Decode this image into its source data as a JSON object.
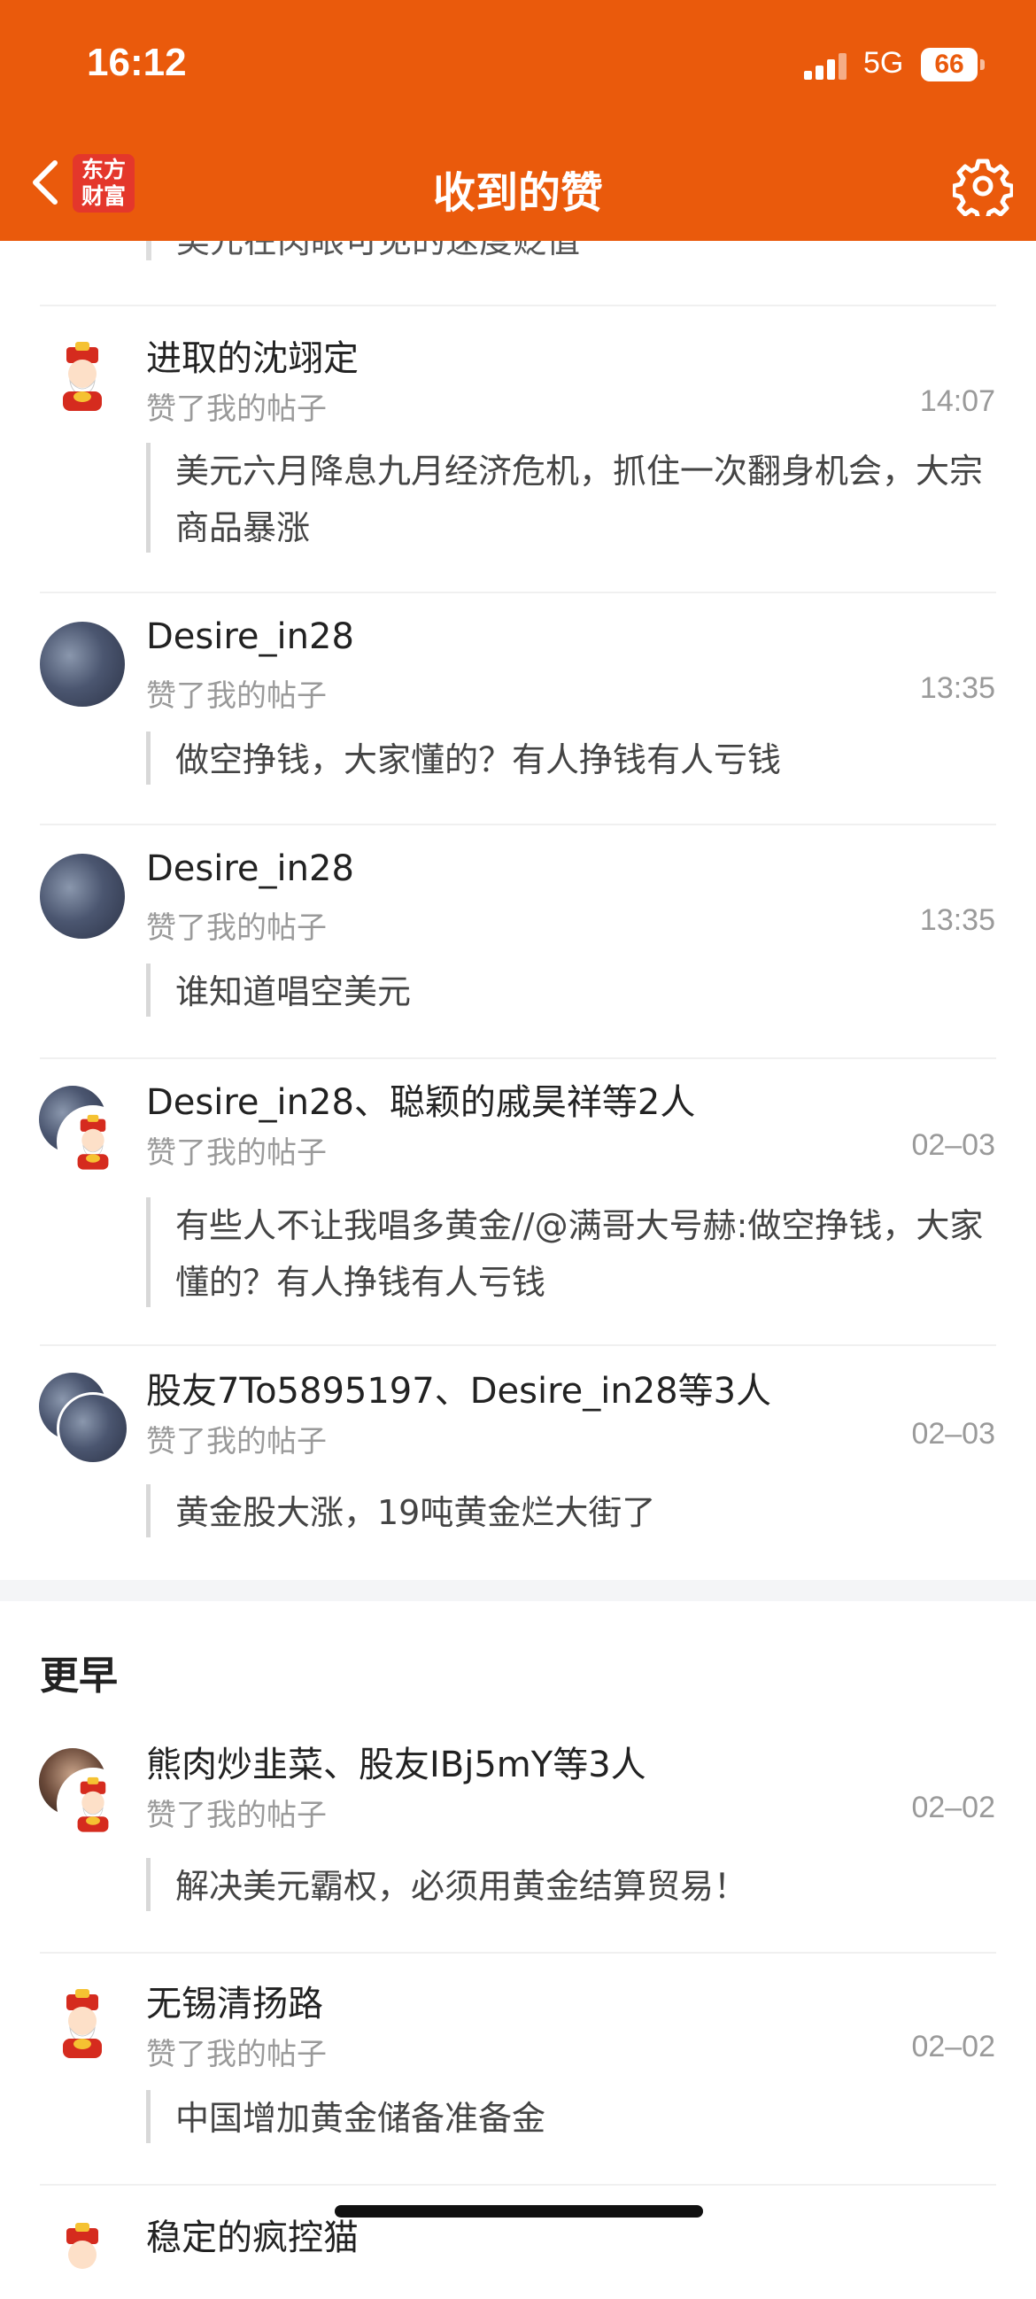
{
  "status_bar": {
    "time": "16:12",
    "network": "5G",
    "battery": "66"
  },
  "header": {
    "logo": "东方财富",
    "logo_line1": "东方",
    "logo_line2": "财富",
    "title": "收到的赞"
  },
  "truncated_top": "美元在肉眼可见的速度贬值",
  "items": [
    {
      "name": "进取的沈翊定",
      "action": "赞了我的帖子",
      "time": "14:07",
      "quote": "美元六月降息九月经济危机，抓住一次翻身机会，大宗商品暴涨"
    },
    {
      "name": "Desire_in28",
      "action": "赞了我的帖子",
      "time": "13:35",
      "quote": "做空挣钱，大家懂的？有人挣钱有人亏钱"
    },
    {
      "name": "Desire_in28",
      "action": "赞了我的帖子",
      "time": "13:35",
      "quote": "谁知道唱空美元"
    },
    {
      "name": "Desire_in28、聪颖的戚昊祥等2人",
      "action": "赞了我的帖子",
      "time": "02–03",
      "quote": "有些人不让我唱多黄金//@满哥大号赫:做空挣钱，大家懂的？有人挣钱有人亏钱"
    },
    {
      "name": "股友7To5895197、Desire_in28等3人",
      "action": "赞了我的帖子",
      "time": "02–03",
      "quote": "黄金股大涨，19吨黄金烂大街了"
    }
  ],
  "section_earlier": "更早",
  "earlier_items": [
    {
      "name": "熊肉炒韭菜、股友IBj5mY等3人",
      "action": "赞了我的帖子",
      "time": "02–02",
      "quote": "解决美元霸权，必须用黄金结算贸易！"
    },
    {
      "name": "无锡清扬路",
      "action": "赞了我的帖子",
      "time": "02–02",
      "quote": "中国增加黄金储备准备金"
    },
    {
      "name": "稳定的疯控猫"
    }
  ],
  "colors": {
    "brand": "#ea5a0c",
    "logo_red": "#e4372b"
  },
  "icons": [
    "back-icon",
    "settings-gear-icon",
    "signal-icon",
    "battery-icon"
  ]
}
